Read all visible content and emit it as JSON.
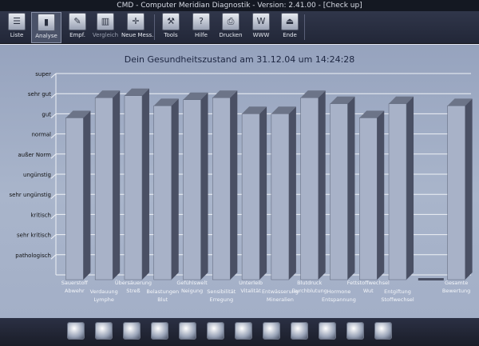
{
  "window": {
    "title": "CMD - Computer Meridian Diagnostik - Version: 2.41.00 - [Check up]"
  },
  "toolbar": {
    "items": [
      {
        "label": "Liste",
        "icon": "list-icon",
        "glyph": "☰"
      },
      {
        "label": "Analyse",
        "icon": "bar-chart-icon",
        "glyph": "▮",
        "active": true
      },
      {
        "label": "Empf.",
        "icon": "recommendation-icon",
        "glyph": "✎"
      },
      {
        "label": "Vergleich",
        "icon": "compare-icon",
        "glyph": "▥",
        "disabled": true
      },
      {
        "label": "Neue Mess.",
        "icon": "new-measurement-icon",
        "glyph": "✛"
      },
      {
        "label": "Tools",
        "icon": "tools-icon",
        "glyph": "⚒"
      },
      {
        "label": "Hilfe",
        "icon": "help-icon",
        "glyph": "?"
      },
      {
        "label": "Drucken",
        "icon": "printer-icon",
        "glyph": "⎙"
      },
      {
        "label": "WWW",
        "icon": "web-icon",
        "glyph": "W"
      },
      {
        "label": "Ende",
        "icon": "exit-icon",
        "glyph": "⏏"
      }
    ]
  },
  "bottombar": {
    "icons": [
      "globe-icon",
      "tooth-icon",
      "grid-icon",
      "cells-icon",
      "heart-icon",
      "vessel-icon",
      "kidney-icon",
      "eye-icon",
      "nerve-icon",
      "ear-icon",
      "joint-icon",
      "checker-icon"
    ]
  },
  "colors": {
    "bar_front": "#a8b2c8",
    "bar_side": "#4a5064",
    "bar_top": "#6c7488",
    "grid": "#eef1f6",
    "title": "#1c2540"
  },
  "chart_data": {
    "type": "bar",
    "title": "Dein Gesundheitszustand am 31.12.04 um 14:24:28",
    "y_levels": [
      "pathologisch",
      "sehr kritisch",
      "kritisch",
      "sehr ungünstig",
      "ungünstig",
      "außer Norm",
      "normal",
      "gut",
      "sehr gut",
      "super"
    ],
    "ylim": [
      0,
      10
    ],
    "grid": true,
    "categories": [
      {
        "line1": "Sauerstoff",
        "line2": "Abwehr"
      },
      {
        "line1": "Verdauung",
        "line2": "Lymphe"
      },
      {
        "line1": "Übersäuerung",
        "line2": "Streß"
      },
      {
        "line1": "Belastungen",
        "line2": "Blut"
      },
      {
        "line1": "Gefühlswelt",
        "line2": "Neigung"
      },
      {
        "line1": "Sensibilität",
        "line2": "Erregung"
      },
      {
        "line1": "Unterleib",
        "line2": "Vitalität"
      },
      {
        "line1": "Entwässerung",
        "line2": "Mineralien"
      },
      {
        "line1": "Blutdruck",
        "line2": "Durchblutung"
      },
      {
        "line1": "Hormone",
        "line2": "Entspannung"
      },
      {
        "line1": "Fettstoffwechsel",
        "line2": "Wut"
      },
      {
        "line1": "Entgiftung",
        "line2": "Stoffwechsel"
      },
      {
        "line1": "",
        "line2": ""
      },
      {
        "line1": "Gesamte",
        "line2": "Bewertung"
      }
    ],
    "values": [
      7.8,
      8.8,
      8.9,
      8.4,
      8.7,
      8.8,
      8.0,
      8.0,
      8.8,
      8.5,
      7.8,
      8.5,
      null,
      8.4
    ]
  }
}
